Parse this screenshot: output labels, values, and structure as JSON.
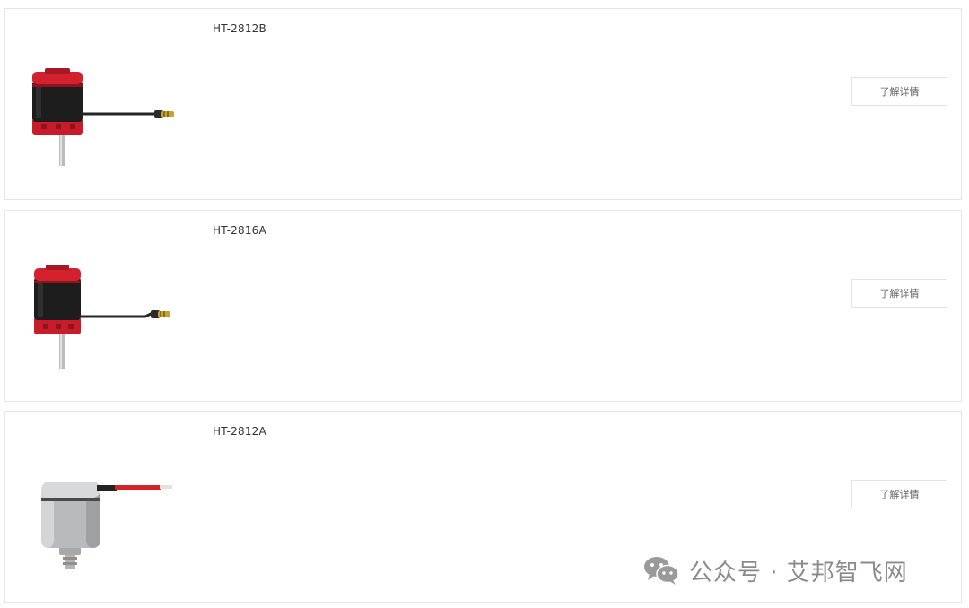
{
  "products": [
    {
      "model": "HT-2812B",
      "button_label": "了解详情",
      "image": "red-outrunner-motor-with-lead"
    },
    {
      "model": "HT-2816A",
      "button_label": "了解详情",
      "image": "red-outrunner-motor-with-lead"
    },
    {
      "model": "HT-2812A",
      "button_label": "了解详情",
      "image": "silver-motor-with-red-wire"
    }
  ],
  "watermark": {
    "icon": "wechat-icon",
    "text": "公众号 · 艾邦智飞网"
  },
  "colors": {
    "motor_red": "#d4212e",
    "motor_black": "#1c1c1c",
    "motor_silver": "#b9babc",
    "border": "#e6e6e6"
  }
}
